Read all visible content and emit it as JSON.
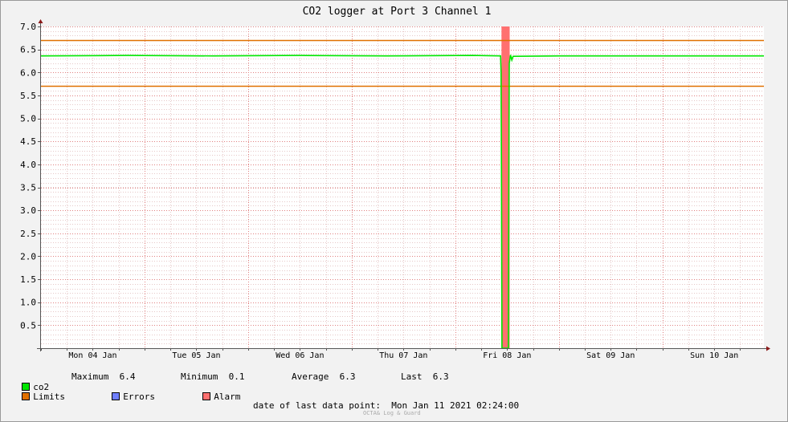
{
  "chart_data": {
    "type": "line",
    "title": "CO2 logger at Port 3 Channel 1",
    "xlabel": "",
    "ylabel": "",
    "x_tick_labels": [
      "Mon 04 Jan",
      "Tue 05 Jan",
      "Wed 06 Jan",
      "Thu 07 Jan",
      "Fri 08 Jan",
      "Sat 09 Jan",
      "Sun 10 Jan"
    ],
    "x_tick_hours": [
      12,
      36,
      60,
      84,
      108,
      132,
      156
    ],
    "xlim_hours": [
      0,
      167.5
    ],
    "x_origin": "2021-01-04 00:00",
    "ylim": [
      0,
      7.0
    ],
    "y_ticks": [
      "0.5",
      "1.0",
      "1.5",
      "2.0",
      "2.5",
      "3.0",
      "3.5",
      "4.0",
      "4.5",
      "5.0",
      "5.5",
      "6.0",
      "6.5",
      "7.0"
    ],
    "grid": true,
    "limits": [
      5.7,
      6.7
    ],
    "alarm_span_hours": [
      106.7,
      108.6
    ],
    "series": [
      {
        "name": "co2",
        "color": "#00e600",
        "points": [
          [
            0,
            6.36
          ],
          [
            20,
            6.37
          ],
          [
            40,
            6.36
          ],
          [
            60,
            6.37
          ],
          [
            80,
            6.36
          ],
          [
            100,
            6.37
          ],
          [
            106.5,
            6.36
          ],
          [
            106.6,
            6.0
          ],
          [
            106.7,
            3.85
          ],
          [
            106.8,
            0.0
          ],
          [
            108.3,
            0.0
          ],
          [
            108.4,
            3.55
          ],
          [
            108.5,
            6.2
          ],
          [
            108.8,
            6.38
          ],
          [
            109.1,
            6.27
          ],
          [
            109.4,
            6.35
          ],
          [
            120,
            6.36
          ],
          [
            140,
            6.36
          ],
          [
            160,
            6.36
          ],
          [
            167.5,
            6.36
          ]
        ]
      }
    ]
  },
  "legend": {
    "co2": "co2",
    "max_label": "Maximum",
    "max_value": "6.4",
    "min_label": "Minimum",
    "min_value": "0.1",
    "avg_label": "Average",
    "avg_value": "6.3",
    "last_label": "Last",
    "last_value": "6.3",
    "limits": "Limits",
    "errors": "Errors",
    "alarm": "Alarm"
  },
  "colors": {
    "co2": "#00e600",
    "limits": "#e07000",
    "errors": "#6f7fff",
    "alarm": "#ff7070"
  },
  "footer": {
    "last_point_label": "date of last data point:",
    "last_point_value": "Mon Jan 11 2021 02:24:00",
    "watermark": "OCTA& Log & Guard"
  }
}
